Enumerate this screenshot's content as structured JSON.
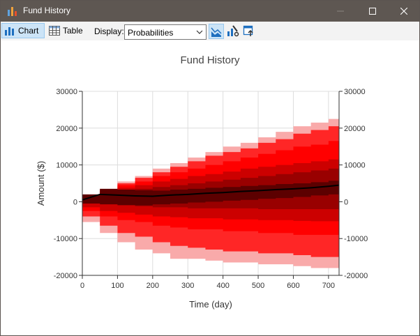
{
  "window": {
    "title": "Fund History"
  },
  "toolbar": {
    "chart_label": "Chart",
    "table_label": "Table",
    "display_label": "Display:",
    "display_value": "Probabilities"
  },
  "colors": {
    "titlebar": "#5e5752",
    "toolbar_selected": "#cce4f7",
    "band_outer": "#f9aaaa",
    "band_5": "#ff2626",
    "band_4": "#ff0000",
    "band_3": "#cc0000",
    "band_2": "#990000",
    "band_1": "#5c0000",
    "median": "#000000"
  },
  "chart_data": {
    "type": "area",
    "title": "Fund History",
    "xlabel": "Time (day)",
    "ylabel": "Amount ($)",
    "xlim": [
      0,
      730
    ],
    "ylim": [
      -20000,
      30000
    ],
    "x_ticks": [
      "0",
      "100",
      "200",
      "300",
      "400",
      "500",
      "600",
      "700"
    ],
    "y_ticks": [
      "-20000",
      "-10000",
      "0",
      "10000",
      "20000",
      "30000"
    ],
    "grid": true,
    "legend": "none",
    "x": [
      0,
      50,
      100,
      150,
      200,
      250,
      300,
      350,
      400,
      450,
      500,
      550,
      600,
      650,
      700,
      730
    ],
    "bands": [
      {
        "name": "",
        "upper": [
          0,
          3500,
          5500,
          7000,
          9000,
          10500,
          12000,
          13500,
          15000,
          16000,
          17500,
          19000,
          20500,
          21500,
          22500,
          23000
        ],
        "lower": [
          0,
          -5500,
          -8500,
          -11000,
          -13000,
          -14000,
          -15500,
          -15500,
          -16000,
          -16500,
          -16500,
          -17000,
          -17000,
          -17500,
          -18000,
          -18000
        ]
      },
      {
        "name": "",
        "upper": [
          0,
          3200,
          5000,
          6500,
          8000,
          9500,
          11000,
          12500,
          13500,
          14500,
          16000,
          17000,
          18500,
          19500,
          20500,
          21000
        ],
        "lower": [
          0,
          -4000,
          -6500,
          -8500,
          -9500,
          -11000,
          -12000,
          -12500,
          -13000,
          -13500,
          -13500,
          -14000,
          -14000,
          -14500,
          -15000,
          -15000
        ]
      },
      {
        "name": "",
        "upper": [
          0,
          3000,
          4500,
          5500,
          7000,
          8000,
          9000,
          10000,
          11000,
          12000,
          13000,
          14000,
          15000,
          15500,
          16500,
          17000
        ],
        "lower": [
          0,
          -2500,
          -4000,
          -5000,
          -5500,
          -6500,
          -7000,
          -7500,
          -7500,
          -8000,
          -8000,
          -8500,
          -8500,
          -9000,
          -9000,
          -9000
        ]
      },
      {
        "name": "",
        "upper": [
          0,
          2800,
          3800,
          4500,
          5500,
          6200,
          7000,
          7500,
          8200,
          9000,
          9500,
          10000,
          10500,
          11000,
          11500,
          12000
        ],
        "lower": [
          0,
          -1500,
          -2500,
          -3000,
          -3500,
          -4000,
          -4200,
          -4500,
          -4500,
          -4800,
          -4800,
          -5000,
          -5000,
          -5200,
          -5300,
          -5300
        ]
      },
      {
        "name": "",
        "upper": [
          0,
          2500,
          3000,
          3500,
          4000,
          4500,
          5000,
          5500,
          6000,
          6500,
          7000,
          7500,
          8000,
          8500,
          9000,
          9200
        ],
        "lower": [
          0,
          0,
          -500,
          -1000,
          -1200,
          -1500,
          -1500,
          -1800,
          -1800,
          -1800,
          -1800,
          -2000,
          -2000,
          -2000,
          -2000,
          -2000
        ]
      }
    ],
    "series": [
      {
        "name": "",
        "values": [
          500,
          2000,
          1800,
          1600,
          1500,
          1800,
          2000,
          2300,
          2500,
          2800,
          3000,
          3300,
          3500,
          3800,
          4200,
          4500
        ]
      }
    ]
  }
}
